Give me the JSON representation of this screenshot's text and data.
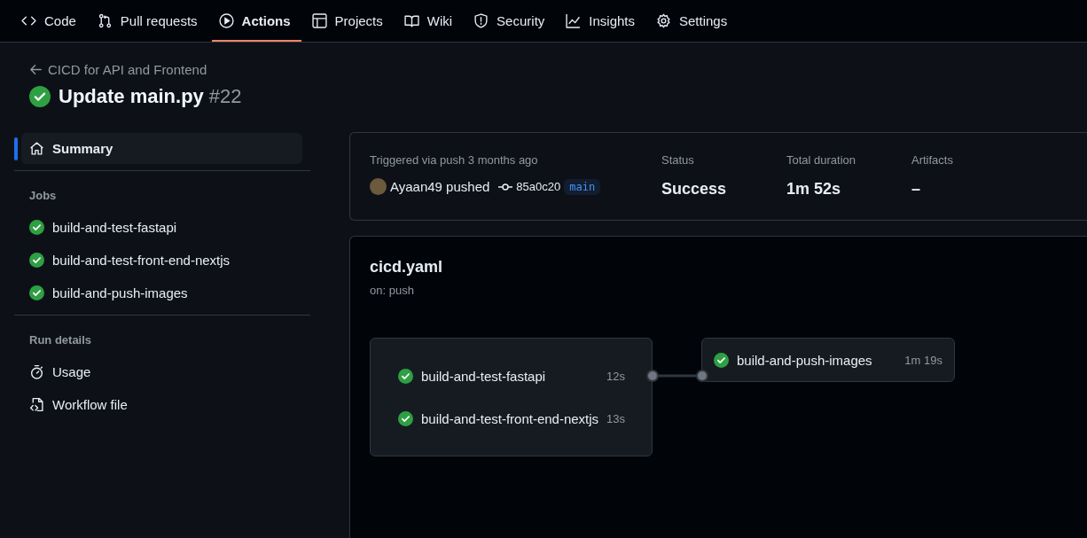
{
  "nav_tabs": [
    {
      "label": "Code",
      "selected": false
    },
    {
      "label": "Pull requests",
      "selected": false
    },
    {
      "label": "Actions",
      "selected": true
    },
    {
      "label": "Projects",
      "selected": false
    },
    {
      "label": "Wiki",
      "selected": false
    },
    {
      "label": "Security",
      "selected": false
    },
    {
      "label": "Insights",
      "selected": false
    },
    {
      "label": "Settings",
      "selected": false
    }
  ],
  "header": {
    "back_link": "CICD for API and Frontend",
    "title": "Update main.py",
    "run_number": "#22",
    "passed": true
  },
  "sidebar": {
    "summary": {
      "label": "Summary",
      "selected": true
    },
    "jobs_heading": "Jobs",
    "jobs": [
      {
        "label": "build-and-test-fastapi",
        "passed": true,
        "selected": false
      },
      {
        "label": "build-and-test-front-end-nextjs",
        "passed": true,
        "selected": false
      },
      {
        "label": "build-and-push-images",
        "passed": true,
        "selected": false
      }
    ],
    "details_heading": "Run details",
    "details": [
      {
        "label": "Usage",
        "selected": false
      },
      {
        "label": "Workflow file",
        "selected": false
      }
    ]
  },
  "run_info": {
    "trigger": "Triggered via push 3 months ago",
    "actor": "Ayaan49 pushed",
    "commit": "85a0c20",
    "branch": "main",
    "stats": [
      {
        "label": "Status",
        "value": "Success"
      },
      {
        "label": "Total duration",
        "value": "1m 52s"
      },
      {
        "label": "Artifacts",
        "value": "–"
      }
    ]
  },
  "workflow": {
    "file": "cicd.yaml",
    "trigger": "on: push",
    "groups": [
      {
        "jobs": [
          {
            "name": "build-and-test-fastapi",
            "duration": "12s",
            "passed": true
          },
          {
            "name": "build-and-test-front-end-nextjs",
            "duration": "13s",
            "passed": true
          }
        ]
      },
      {
        "jobs": [
          {
            "name": "build-and-push-images",
            "duration": "1m 19s",
            "passed": true
          }
        ]
      }
    ]
  }
}
